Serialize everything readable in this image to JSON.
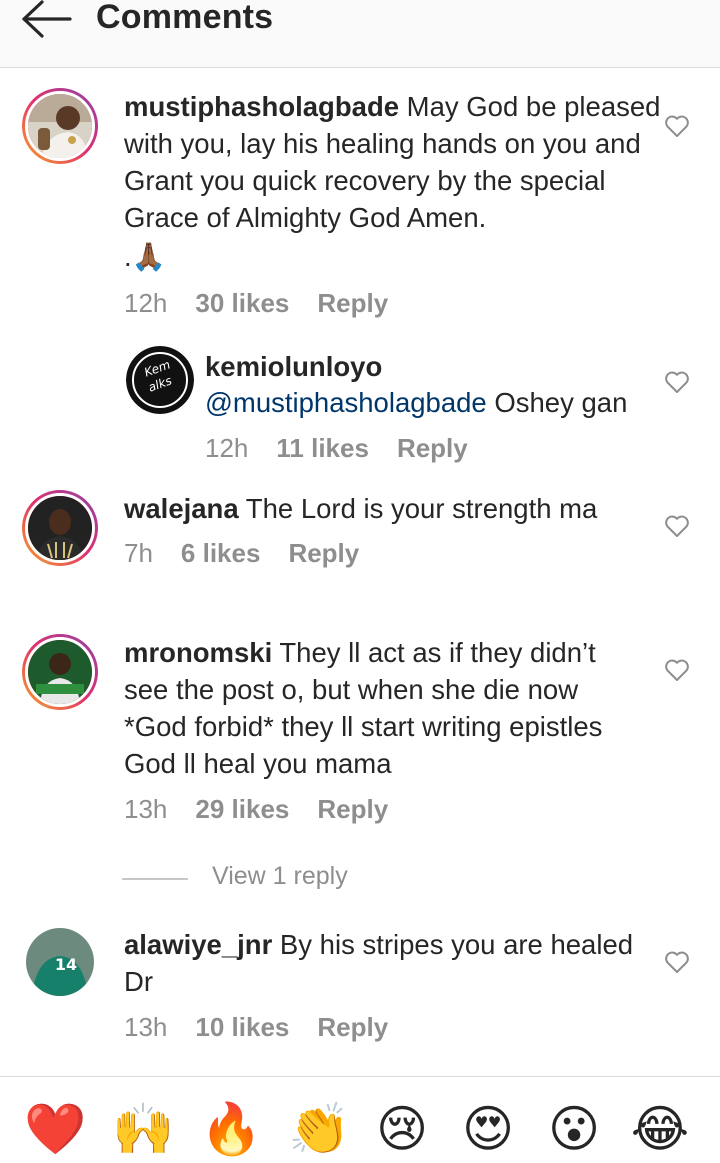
{
  "header": {
    "title": "Comments",
    "back_icon": "arrow-left-icon"
  },
  "comments": [
    {
      "username": "mustiphasholagbade",
      "text": " May God be pleased with you, lay his healing hands on you and Grant you quick recovery by the special Grace of Almighty God Amen.",
      "emoji_line": ".🙏🏾",
      "time": "12h",
      "likes": "30 likes",
      "reply": "Reply"
    },
    {
      "username": "kemiolunloyo",
      "mention": "@mustiphasholagbade",
      "text": " Oshey gan",
      "time": "12h",
      "likes": "11 likes",
      "reply": "Reply"
    },
    {
      "username": "walejana",
      "text": " The Lord is your strength ma",
      "time": "7h",
      "likes": "6 likes",
      "reply": "Reply"
    },
    {
      "username": "mronomski",
      "text": " They ll act as if they didn’t see the post o, but when she die now *God forbid* they ll start writing epistles God ll heal you mama",
      "time": "13h",
      "likes": "29 likes",
      "reply": "Reply",
      "view_replies": "View 1 reply"
    },
    {
      "username": "alawiye_jnr",
      "text": " By his stripes you are healed Dr",
      "time": "13h",
      "likes": "10 likes",
      "reply": "Reply"
    }
  ],
  "avatar_badge_text": {
    "kemi_line1": "Kem",
    "kemi_line2": "alks",
    "jersey_number": "14"
  },
  "emoji_bar": [
    "❤️",
    "🙌",
    "🔥",
    "👏",
    "😢",
    "😍",
    "😮",
    "😂"
  ],
  "colors": {
    "text": "#262626",
    "secondary": "#8e8e8e",
    "mention": "#00376b",
    "divider": "#dbdbdb"
  }
}
